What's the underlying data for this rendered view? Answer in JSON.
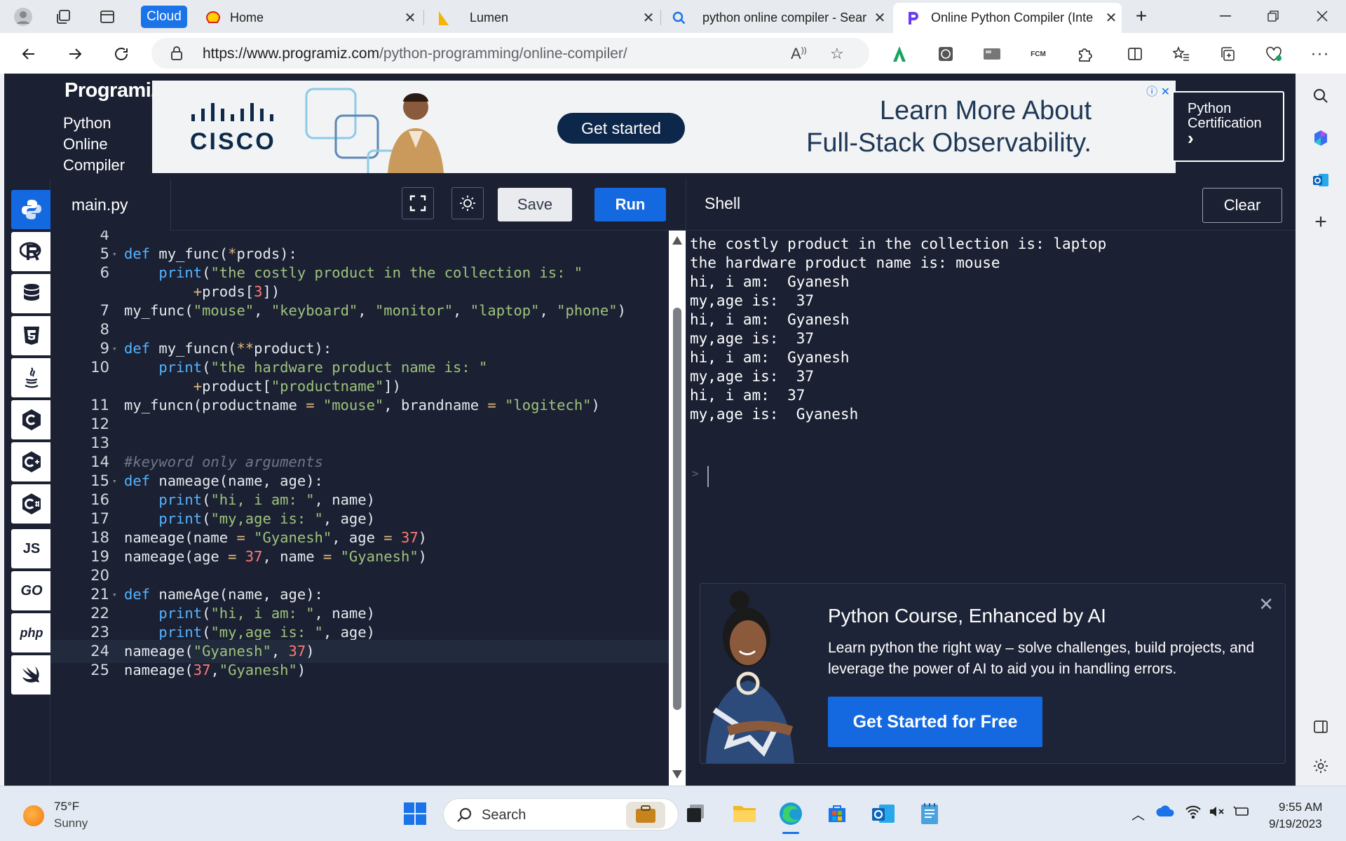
{
  "browser": {
    "cloud_badge": "Cloud",
    "tabs": [
      {
        "title": "Home",
        "close": "✕"
      },
      {
        "title": "Lumen",
        "close": "✕"
      },
      {
        "title": "python online compiler - Sear",
        "close": "✕"
      },
      {
        "title": "Online Python Compiler (Inte",
        "close": "✕"
      }
    ],
    "url_host": "https://www.programiz.com",
    "url_path": "/python-programming/online-compiler/",
    "new_tab": "+"
  },
  "site": {
    "logo": "Programiz",
    "subtitle_lines": [
      "Python",
      "Online",
      "Compiler"
    ],
    "ad": {
      "brand": "CISCO",
      "cta": "Get started",
      "headline_1": "Learn More About",
      "headline_2": "Full-Stack Observability."
    },
    "cert_line1": "Python",
    "cert_line2": "Certification",
    "cert_arrow": "›"
  },
  "rail": [
    "python",
    "R",
    "SQL",
    "HTML5",
    "Java",
    "C",
    "C++",
    "C#",
    "JS",
    "GO",
    "php",
    "Swift"
  ],
  "editor": {
    "file_name": "main.py",
    "save_label": "Save",
    "run_label": "Run",
    "lines": [
      {
        "n": "4",
        "fold": false,
        "html": ""
      },
      {
        "n": "5",
        "fold": true,
        "html": "<span class='kw'>def</span> my_func(<span class='op'>*</span>prods):"
      },
      {
        "n": "6",
        "fold": false,
        "html": "    <span class='kw'>print</span>(<span class='str'>\"the costly product in the collection is: \"</span>"
      },
      {
        "n": "",
        "fold": false,
        "html": "        <span class='op'>+</span>prods[<span class='num'>3</span>])"
      },
      {
        "n": "7",
        "fold": false,
        "html": "my_func(<span class='str'>\"mouse\"</span>, <span class='str'>\"keyboard\"</span>, <span class='str'>\"monitor\"</span>, <span class='str'>\"laptop\"</span>, <span class='str'>\"phone\"</span>)"
      },
      {
        "n": "8",
        "fold": false,
        "html": ""
      },
      {
        "n": "9",
        "fold": true,
        "html": "<span class='kw'>def</span> my_funcn(<span class='op'>**</span>product):"
      },
      {
        "n": "10",
        "fold": false,
        "html": "    <span class='kw'>print</span>(<span class='str'>\"the hardware product name is: \"</span>"
      },
      {
        "n": "",
        "fold": false,
        "html": "        <span class='op'>+</span>product[<span class='str'>\"productname\"</span>])"
      },
      {
        "n": "11",
        "fold": false,
        "html": "my_funcn(productname <span class='op'>=</span> <span class='str'>\"mouse\"</span>, brandname <span class='op'>=</span> <span class='str'>\"logitech\"</span>)"
      },
      {
        "n": "12",
        "fold": false,
        "html": ""
      },
      {
        "n": "13",
        "fold": false,
        "html": ""
      },
      {
        "n": "14",
        "fold": false,
        "html": "<span class='cmt'>#keyword only arguments</span>"
      },
      {
        "n": "15",
        "fold": true,
        "html": "<span class='kw'>def</span> nameage(name, age):"
      },
      {
        "n": "16",
        "fold": false,
        "html": "    <span class='kw'>print</span>(<span class='str'>\"hi, i am: \"</span>, name)"
      },
      {
        "n": "17",
        "fold": false,
        "html": "    <span class='kw'>print</span>(<span class='str'>\"my,age is: \"</span>, age)"
      },
      {
        "n": "18",
        "fold": false,
        "html": "nameage(name <span class='op'>=</span> <span class='str'>\"Gyanesh\"</span>, age <span class='op'>=</span> <span class='num'>37</span>)"
      },
      {
        "n": "19",
        "fold": false,
        "html": "nameage(age <span class='op'>=</span> <span class='num'>37</span>, name <span class='op'>=</span> <span class='str'>\"Gyanesh\"</span>)"
      },
      {
        "n": "20",
        "fold": false,
        "html": ""
      },
      {
        "n": "21",
        "fold": true,
        "html": "<span class='kw'>def</span> nameAge(name, age):"
      },
      {
        "n": "22",
        "fold": false,
        "html": "    <span class='kw'>print</span>(<span class='str'>\"hi, i am: \"</span>, name)"
      },
      {
        "n": "23",
        "fold": false,
        "html": "    <span class='kw'>print</span>(<span class='str'>\"my,age is: \"</span>, age)"
      },
      {
        "n": "24",
        "fold": false,
        "hl": true,
        "html": "nameage(<span class='str'>\"Gyanesh\"</span>, <span class='num'>37</span>)"
      },
      {
        "n": "25",
        "fold": false,
        "html": "nameage(<span class='num'>37</span>,<span class='str'>\"Gyanesh\"</span>)"
      }
    ]
  },
  "shell": {
    "title": "Shell",
    "clear_label": "Clear",
    "prompt": ">",
    "output": [
      "the costly product in the collection is: laptop",
      "the hardware product name is: mouse",
      "hi, i am:  Gyanesh",
      "my,age is:  37",
      "hi, i am:  Gyanesh",
      "my,age is:  37",
      "hi, i am:  Gyanesh",
      "my,age is:  37",
      "hi, i am:  37",
      "my,age is:  Gyanesh"
    ]
  },
  "promo": {
    "title": "Python Course, Enhanced by AI",
    "body": "Learn python the right way – solve challenges, build projects, and leverage the power of AI to aid you in handling errors.",
    "cta": "Get Started for Free",
    "close": "✕"
  },
  "taskbar": {
    "temp": "75°F",
    "condition": "Sunny",
    "search_placeholder": "Search",
    "time": "9:55 AM",
    "date": "9/19/2023"
  },
  "colors": {
    "accent": "#1569e0",
    "page_bg": "#1b2133",
    "keyword": "#56b3ff",
    "string": "#9ec37b",
    "number": "#ff7b72"
  }
}
